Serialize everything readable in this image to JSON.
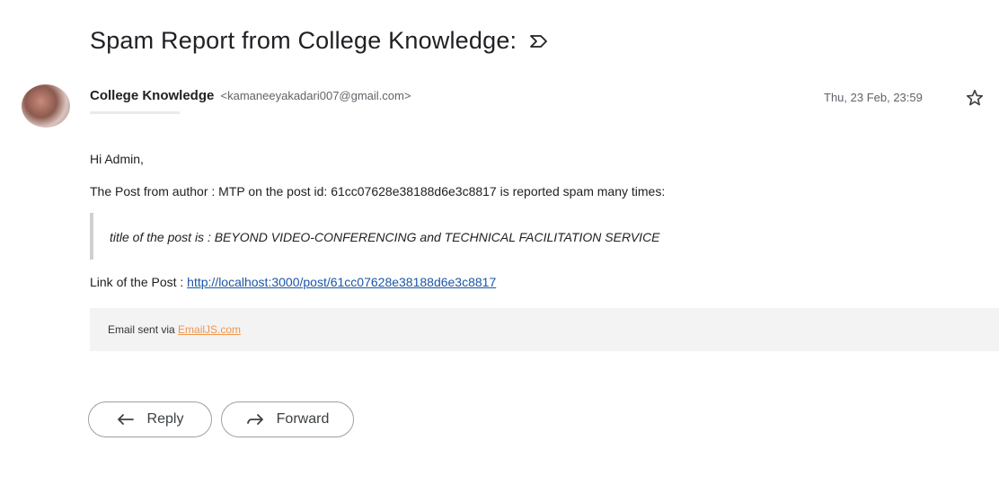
{
  "email": {
    "subject": "Spam Report from College Knowledge:",
    "sender_name": "College Knowledge",
    "sender_email": "<kamaneeyakadari007@gmail.com>",
    "date": "Thu, 23 Feb, 23:59",
    "greeting": "Hi Admin,",
    "report_line": "The Post from author :  MTP on the post id: 61cc07628e38188d6e3c8817 is reported spam many times:",
    "quote": "title of the post is : BEYOND VIDEO-CONFERENCING and TECHNICAL FACILITATION SERVICE",
    "link_prefix": "Link of the Post : ",
    "link_url": "http://localhost:3000/post/61cc07628e38188d6e3c8817",
    "footer_prefix": "Email sent via ",
    "footer_link": "EmailJS.com"
  },
  "actions": {
    "reply_label": "Reply",
    "forward_label": "Forward"
  },
  "icons": {
    "important": "important-marker-icon",
    "star": "star-icon",
    "reply": "reply-arrow-icon",
    "forward": "forward-arrow-icon"
  },
  "colors": {
    "link": "#1a56a8",
    "footer_link": "#f0954a",
    "footer_bg": "#f3f3f3"
  }
}
